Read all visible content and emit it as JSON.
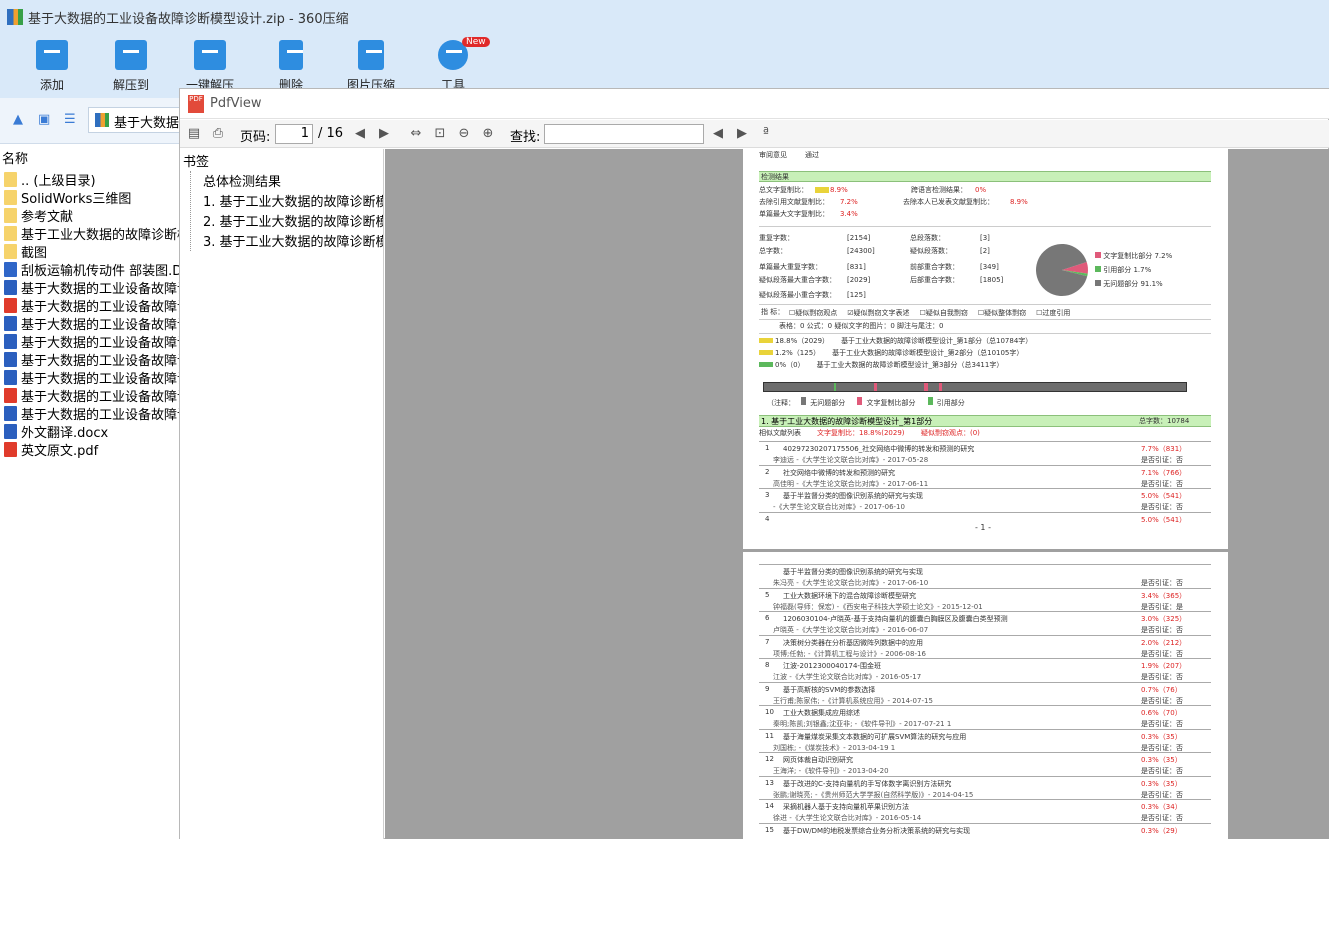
{
  "zip": {
    "title": "基于大数据的工业设备故障诊断模型设计.zip - 360压缩",
    "toolbar": [
      {
        "label": "添加",
        "icon": "add-icon"
      },
      {
        "label": "解压到",
        "icon": "extract-icon"
      },
      {
        "label": "一键解压",
        "icon": "one-click-extract-icon"
      },
      {
        "label": "删除",
        "icon": "delete-icon"
      },
      {
        "label": "图片压缩",
        "icon": "image-compress-icon"
      },
      {
        "label": "工具",
        "icon": "tools-icon",
        "badge": "New"
      }
    ],
    "address": "基于大数据的",
    "column_name": "名称",
    "files": [
      {
        "name": ".. (上级目录)",
        "type": "folder"
      },
      {
        "name": "SolidWorks三维图",
        "type": "folder"
      },
      {
        "name": "参考文献",
        "type": "folder"
      },
      {
        "name": "基于工业大数据的故障诊断模型",
        "type": "folder"
      },
      {
        "name": "截图",
        "type": "folder"
      },
      {
        "name": "刮板运输机传动件 部装图.DW",
        "type": "dwg"
      },
      {
        "name": "基于大数据的工业设备故障诊断",
        "type": "doc"
      },
      {
        "name": "基于大数据的工业设备故障诊断",
        "type": "pdf"
      },
      {
        "name": "基于大数据的工业设备故障诊断",
        "type": "doc"
      },
      {
        "name": "基于大数据的工业设备故障诊断",
        "type": "doc"
      },
      {
        "name": "基于大数据的工业设备故障诊断",
        "type": "doc"
      },
      {
        "name": "基于大数据的工业设备故障诊断",
        "type": "doc"
      },
      {
        "name": "基于大数据的工业设备故障诊断",
        "type": "pdf"
      },
      {
        "name": "基于大数据的工业设备故障诊断",
        "type": "doc"
      },
      {
        "name": "外文翻译.docx",
        "type": "doc"
      },
      {
        "name": "英文原文.pdf",
        "type": "pdf"
      }
    ]
  },
  "pdf": {
    "title": "PdfView",
    "page_label": "页码:",
    "page_current": "1",
    "page_total": "/ 16",
    "find_label": "查找:",
    "bookmarks_header": "书签",
    "bookmarks": [
      "总体检测结果",
      "1. 基于工业大数据的故障诊断模型",
      "2. 基于工业大数据的故障诊断模型",
      "3. 基于工业大数据的故障诊断模型"
    ],
    "page1": {
      "review_label": "审阅意见",
      "review_value": "通过",
      "result_header": "检测结果",
      "total_copy": "总文字复制比：",
      "total_copy_v": "8.9%",
      "cross_lang": "跨语言检测结果：",
      "cross_lang_v": "0%",
      "excl_ref": "去除引用文献复制比：",
      "excl_ref_v": "7.2%",
      "excl_self": "去除本人已发表文献复制比：",
      "excl_self_v": "8.9%",
      "single_max": "单篇最大文字复制比：",
      "single_max_v": "3.4%",
      "repeat_chars": "重复字数：",
      "repeat_chars_v": "[2154]",
      "total_para": "总段落数：",
      "total_para_v": "[3]",
      "total_chars": "总字数：",
      "total_chars_v": "[24300]",
      "sus_para": "疑似段落数：",
      "sus_para_v": "[2]",
      "single_max_repeat": "单篇最大重复字数：",
      "single_max_repeat_v": "[831]",
      "front_overlap": "前部重合字数：",
      "front_overlap_v": "[349]",
      "sus_max_overlap": "疑似段落最大重合字数：",
      "sus_max_overlap_v": "[2029]",
      "back_overlap": "后部重合字数：",
      "back_overlap_v": "[1805]",
      "sus_min_overlap": "疑似段落最小重合字数：",
      "sus_min_overlap_v": "[125]",
      "legend": [
        {
          "label": "文字复制比部分 7.2%",
          "color": "#e05a7a"
        },
        {
          "label": "引用部分 1.7%",
          "color": "#5cb85c"
        },
        {
          "label": "无问题部分 91.1%",
          "color": "#777777"
        }
      ],
      "pie": [
        7.2,
        1.7,
        91.1
      ],
      "indicator_label": "指  标：",
      "indicators": [
        {
          "label": "疑似剽窃观点",
          "checked": false
        },
        {
          "label": "疑似剽窃文字表述",
          "checked": true
        },
        {
          "label": "疑似自我剽窃",
          "checked": false
        },
        {
          "label": "疑似整体剽窃",
          "checked": false
        },
        {
          "label": "过度引用",
          "checked": false
        }
      ],
      "counts": "表格：0    公式：0    疑似文字的图片：0    脚注与尾注：0",
      "parts": [
        {
          "pct": "18.8%（2029）",
          "desc": "基于工业大数据的故障诊断模型设计_第1部分（总10784字）"
        },
        {
          "pct": "1.2%（125）",
          "desc": "基于工业大数据的故障诊断模型设计_第2部分（总10105字）"
        },
        {
          "pct": "0%（0）",
          "desc": "基于工业大数据的故障诊断模型设计_第3部分（总3411字）"
        }
      ],
      "note": "（注释：",
      "note_items": [
        "无问题部分",
        "文字复制比部分",
        "引用部分"
      ],
      "sec_title": "1. 基于工业大数据的故障诊断模型设计_第1部分",
      "sec_total": "总字数：10784",
      "sec_sub": "相似文献列表",
      "sec_copy": "文字复制比：18.8%(2029)",
      "sec_sus": "疑似剽窃观点：(0)",
      "rows": [
        {
          "n": "1",
          "t": "40297230207175506_社交网络中微博的转发和预测的研究",
          "s": "李迪远 -《大学生论文联合比对库》- 2017-05-28",
          "p": "7.7%（831）",
          "q": "是否引证：否"
        },
        {
          "n": "2",
          "t": "社交网络中微博的转发和预测的研究",
          "s": "高佳明 -《大学生论文联合比对库》- 2017-06-11",
          "p": "7.1%（766）",
          "q": "是否引证：否"
        },
        {
          "n": "3",
          "t": "基于半监督分类的图像识别系统的研究与实现",
          "s": "-《大学生论文联合比对库》- 2017-06-10",
          "p": "5.0%（541）",
          "q": "是否引证：否"
        },
        {
          "n": "4",
          "t": "",
          "s": "",
          "p": "5.0%（541）",
          "q": ""
        }
      ],
      "page_num": "- 1 -"
    },
    "page2": {
      "rows": [
        {
          "n": "",
          "t": "基于半监督分类的图像识别系统的研究与实现",
          "s": "朱冯亮 -《大学生论文联合比对库》- 2017-06-10",
          "p": "",
          "q": "是否引证：否"
        },
        {
          "n": "5",
          "t": "工业大数据环境下的混合故障诊断模型研究",
          "s": "钟福磊(导师：保宏) -《西安电子科技大学硕士论文》- 2015-12-01",
          "p": "3.4%（365）",
          "q": "是否引证：是"
        },
        {
          "n": "6",
          "t": "1206030104-卢晓英-基于支持向量机的腹囊白胸膜区及腹囊白类型预测",
          "s": "卢晓英 -《大学生论文联合比对库》- 2016-06-07",
          "p": "3.0%（325）",
          "q": "是否引证：否"
        },
        {
          "n": "7",
          "t": "决策树分类器在分析基因微阵列数据中的应用",
          "s": "项博;任勃; -《计算机工程与设计》- 2006-08-16",
          "p": "2.0%（212）",
          "q": "是否引证：否"
        },
        {
          "n": "8",
          "t": "江波-2012300040174-围金班",
          "s": "江波 -《大学生论文联合比对库》- 2016-05-17",
          "p": "1.9%（207）",
          "q": "是否引证：否"
        },
        {
          "n": "9",
          "t": "基于高斯核的SVM的参数选择",
          "s": "王行甫;陈家伟; -《计算机系统应用》- 2014-07-15",
          "p": "0.7%（76）",
          "q": "是否引证：否"
        },
        {
          "n": "10",
          "t": "工业大数据集成应用综述",
          "s": "秦明;陈凯;刘银鑫;沈亚非; -《软件导刊》- 2017-07-21 1",
          "p": "0.6%（70）",
          "q": "是否引证：否"
        },
        {
          "n": "11",
          "t": "基于海量煤炭采集文本数据的可扩展SVM算法的研究与应用",
          "s": "刘国栋; -《煤炭技术》- 2013-04-19 1",
          "p": "0.3%（35）",
          "q": "是否引证：否"
        },
        {
          "n": "12",
          "t": "网页体裁自动识别研究",
          "s": "王海洋; -《软件导刊》- 2013-04-20",
          "p": "0.3%（35）",
          "q": "是否引证：否"
        },
        {
          "n": "13",
          "t": "基于改进的C-支持向量机的手写体数字离识别方法研究",
          "s": "张鹏;谢晓亮; -《贵州师范大学学报(自然科学版)》- 2014-04-15",
          "p": "0.3%（35）",
          "q": "是否引证：否"
        },
        {
          "n": "14",
          "t": "采摘机器人基于支持向量机苹果识别方法",
          "s": "徐进 -《大学生论文联合比对库》- 2016-05-14",
          "p": "0.3%（34）",
          "q": "是否引证：否"
        },
        {
          "n": "15",
          "t": "基于DW/DM的地税发票综合业务分析决策系统的研究与实现",
          "s": "",
          "p": "0.3%（29）",
          "q": ""
        }
      ]
    }
  }
}
